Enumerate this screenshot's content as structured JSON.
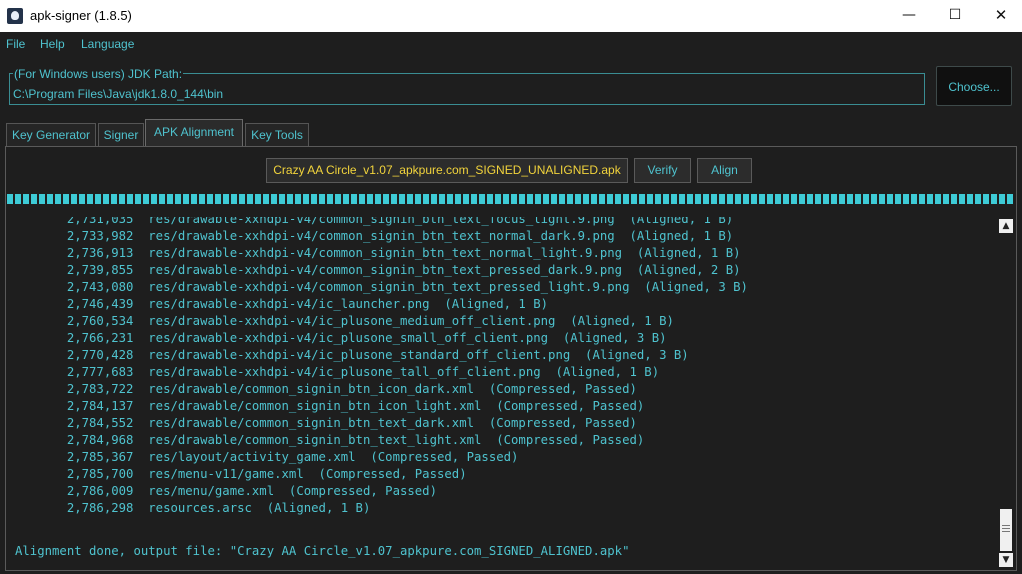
{
  "window": {
    "title": "apk-signer (1.8.5)",
    "icon": "app-icon",
    "controls": {
      "minimize": "—",
      "maximize": "☐",
      "close": "✕"
    }
  },
  "menu": [
    "File",
    "Help",
    "Language"
  ],
  "jdk": {
    "legend": "(For Windows users) JDK Path:",
    "value": "C:\\Program Files\\Java\\jdk1.8.0_144\\bin",
    "choose_label": "Choose..."
  },
  "tabs": [
    {
      "label": "Key Generator",
      "active": false
    },
    {
      "label": "Signer",
      "active": false
    },
    {
      "label": "APK Alignment",
      "active": true
    },
    {
      "label": "Key Tools",
      "active": false
    }
  ],
  "alignment": {
    "file_label": "Crazy AA Circle_v1.07_apkpure.com_SIGNED_UNALIGNED.apk",
    "verify_label": "Verify",
    "align_label": "Align",
    "progress_percent": 100
  },
  "log": {
    "lines": [
      "       2,731,035  res/drawable-xxhdpi-v4/common_signin_btn_text_focus_light.9.png  (Aligned, 1 B)",
      "       2,733,982  res/drawable-xxhdpi-v4/common_signin_btn_text_normal_dark.9.png  (Aligned, 1 B)",
      "       2,736,913  res/drawable-xxhdpi-v4/common_signin_btn_text_normal_light.9.png  (Aligned, 1 B)",
      "       2,739,855  res/drawable-xxhdpi-v4/common_signin_btn_text_pressed_dark.9.png  (Aligned, 2 B)",
      "       2,743,080  res/drawable-xxhdpi-v4/common_signin_btn_text_pressed_light.9.png  (Aligned, 3 B)",
      "       2,746,439  res/drawable-xxhdpi-v4/ic_launcher.png  (Aligned, 1 B)",
      "       2,760,534  res/drawable-xxhdpi-v4/ic_plusone_medium_off_client.png  (Aligned, 1 B)",
      "       2,766,231  res/drawable-xxhdpi-v4/ic_plusone_small_off_client.png  (Aligned, 3 B)",
      "       2,770,428  res/drawable-xxhdpi-v4/ic_plusone_standard_off_client.png  (Aligned, 3 B)",
      "       2,777,683  res/drawable-xxhdpi-v4/ic_plusone_tall_off_client.png  (Aligned, 1 B)",
      "       2,783,722  res/drawable/common_signin_btn_icon_dark.xml  (Compressed, Passed)",
      "       2,784,137  res/drawable/common_signin_btn_icon_light.xml  (Compressed, Passed)",
      "       2,784,552  res/drawable/common_signin_btn_text_dark.xml  (Compressed, Passed)",
      "       2,784,968  res/drawable/common_signin_btn_text_light.xml  (Compressed, Passed)",
      "       2,785,367  res/layout/activity_game.xml  (Compressed, Passed)",
      "       2,785,700  res/menu-v11/game.xml  (Compressed, Passed)",
      "       2,786,009  res/menu/game.xml  (Compressed, Passed)",
      "       2,786,298  resources.arsc  (Aligned, 1 B)"
    ],
    "status": "Alignment done, output file: \"Crazy AA Circle_v1.07_apkpure.com_SIGNED_ALIGNED.apk\""
  },
  "colors": {
    "background": "#1e1e1e",
    "accent": "#4fc3cf",
    "file_button_text": "#f2d43c",
    "progress": "#3ecbd6"
  }
}
